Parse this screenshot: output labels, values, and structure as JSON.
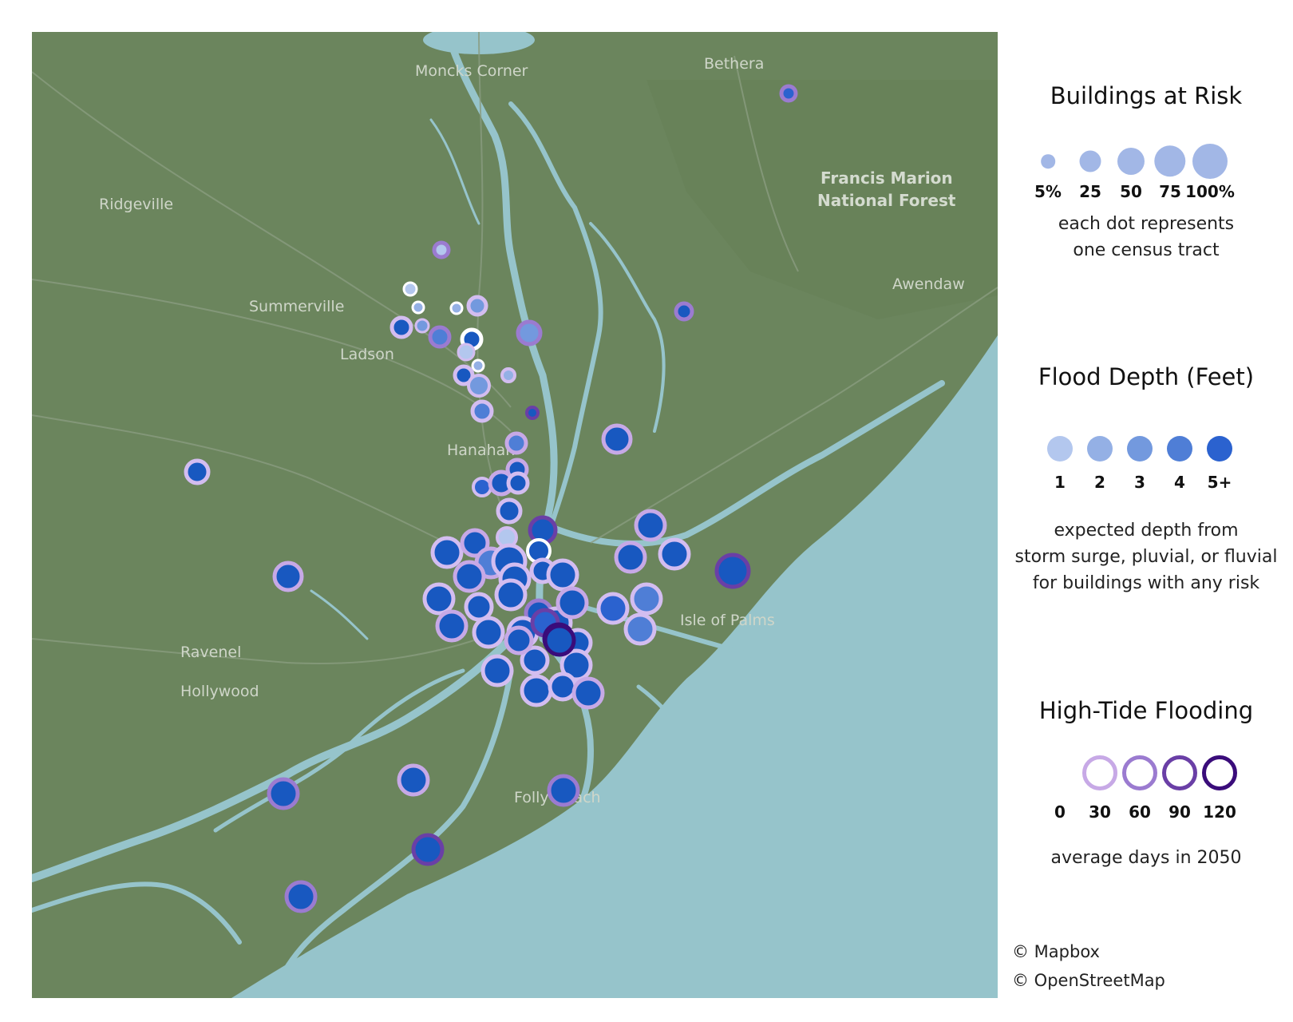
{
  "map": {
    "places": [
      {
        "id": "moncks-corner",
        "name": "Moncks Corner"
      },
      {
        "id": "bethera",
        "name": "Bethera"
      },
      {
        "id": "ridgeville",
        "name": "Ridgeville"
      },
      {
        "id": "francis-marion-1",
        "name": "Francis Marion"
      },
      {
        "id": "francis-marion-2",
        "name": "National Forest"
      },
      {
        "id": "summerville",
        "name": "Summerville"
      },
      {
        "id": "ladson",
        "name": "Ladson"
      },
      {
        "id": "awendaw",
        "name": "Awendaw"
      },
      {
        "id": "hanahan",
        "name": "Hanahan"
      },
      {
        "id": "ravenel",
        "name": "Ravenel"
      },
      {
        "id": "hollywood",
        "name": "Hollywood"
      },
      {
        "id": "isle-of-palms",
        "name": "Isle of Palms"
      },
      {
        "id": "folly-beach",
        "name": "Folly Beach"
      }
    ],
    "colors": {
      "land": "#6b855d",
      "water": "#96c4cb",
      "road": "#8a9c80"
    }
  },
  "legend": {
    "size": {
      "title": "Buildings at Risk",
      "ticks": [
        "5%",
        "25",
        "50",
        "75",
        "100%"
      ],
      "values": [
        5,
        25,
        50,
        75,
        100
      ],
      "note1": "each dot represents",
      "note2": "one census tract"
    },
    "depth": {
      "title": "Flood Depth (Feet)",
      "ticks": [
        "1",
        "2",
        "3",
        "4",
        "5+"
      ],
      "colors": [
        "#b3c7ee",
        "#94b0e5",
        "#7399de",
        "#4f7ed6",
        "#2b62cf"
      ],
      "note1": "expected depth from",
      "note2": "storm surge, pluvial, or fluvial",
      "note3": "for buildings with any risk"
    },
    "tide": {
      "title": "High-Tide Flooding",
      "ticks": [
        "0",
        "30",
        "60",
        "90",
        "120"
      ],
      "colors": [
        "#ffffff",
        "#c7a9e6",
        "#9b7bd0",
        "#6a3fa6",
        "#3a0c7a"
      ],
      "note": "average days in 2050"
    }
  },
  "credits": {
    "mapbox": "© Mapbox",
    "osm": "© OpenStreetMap"
  }
}
